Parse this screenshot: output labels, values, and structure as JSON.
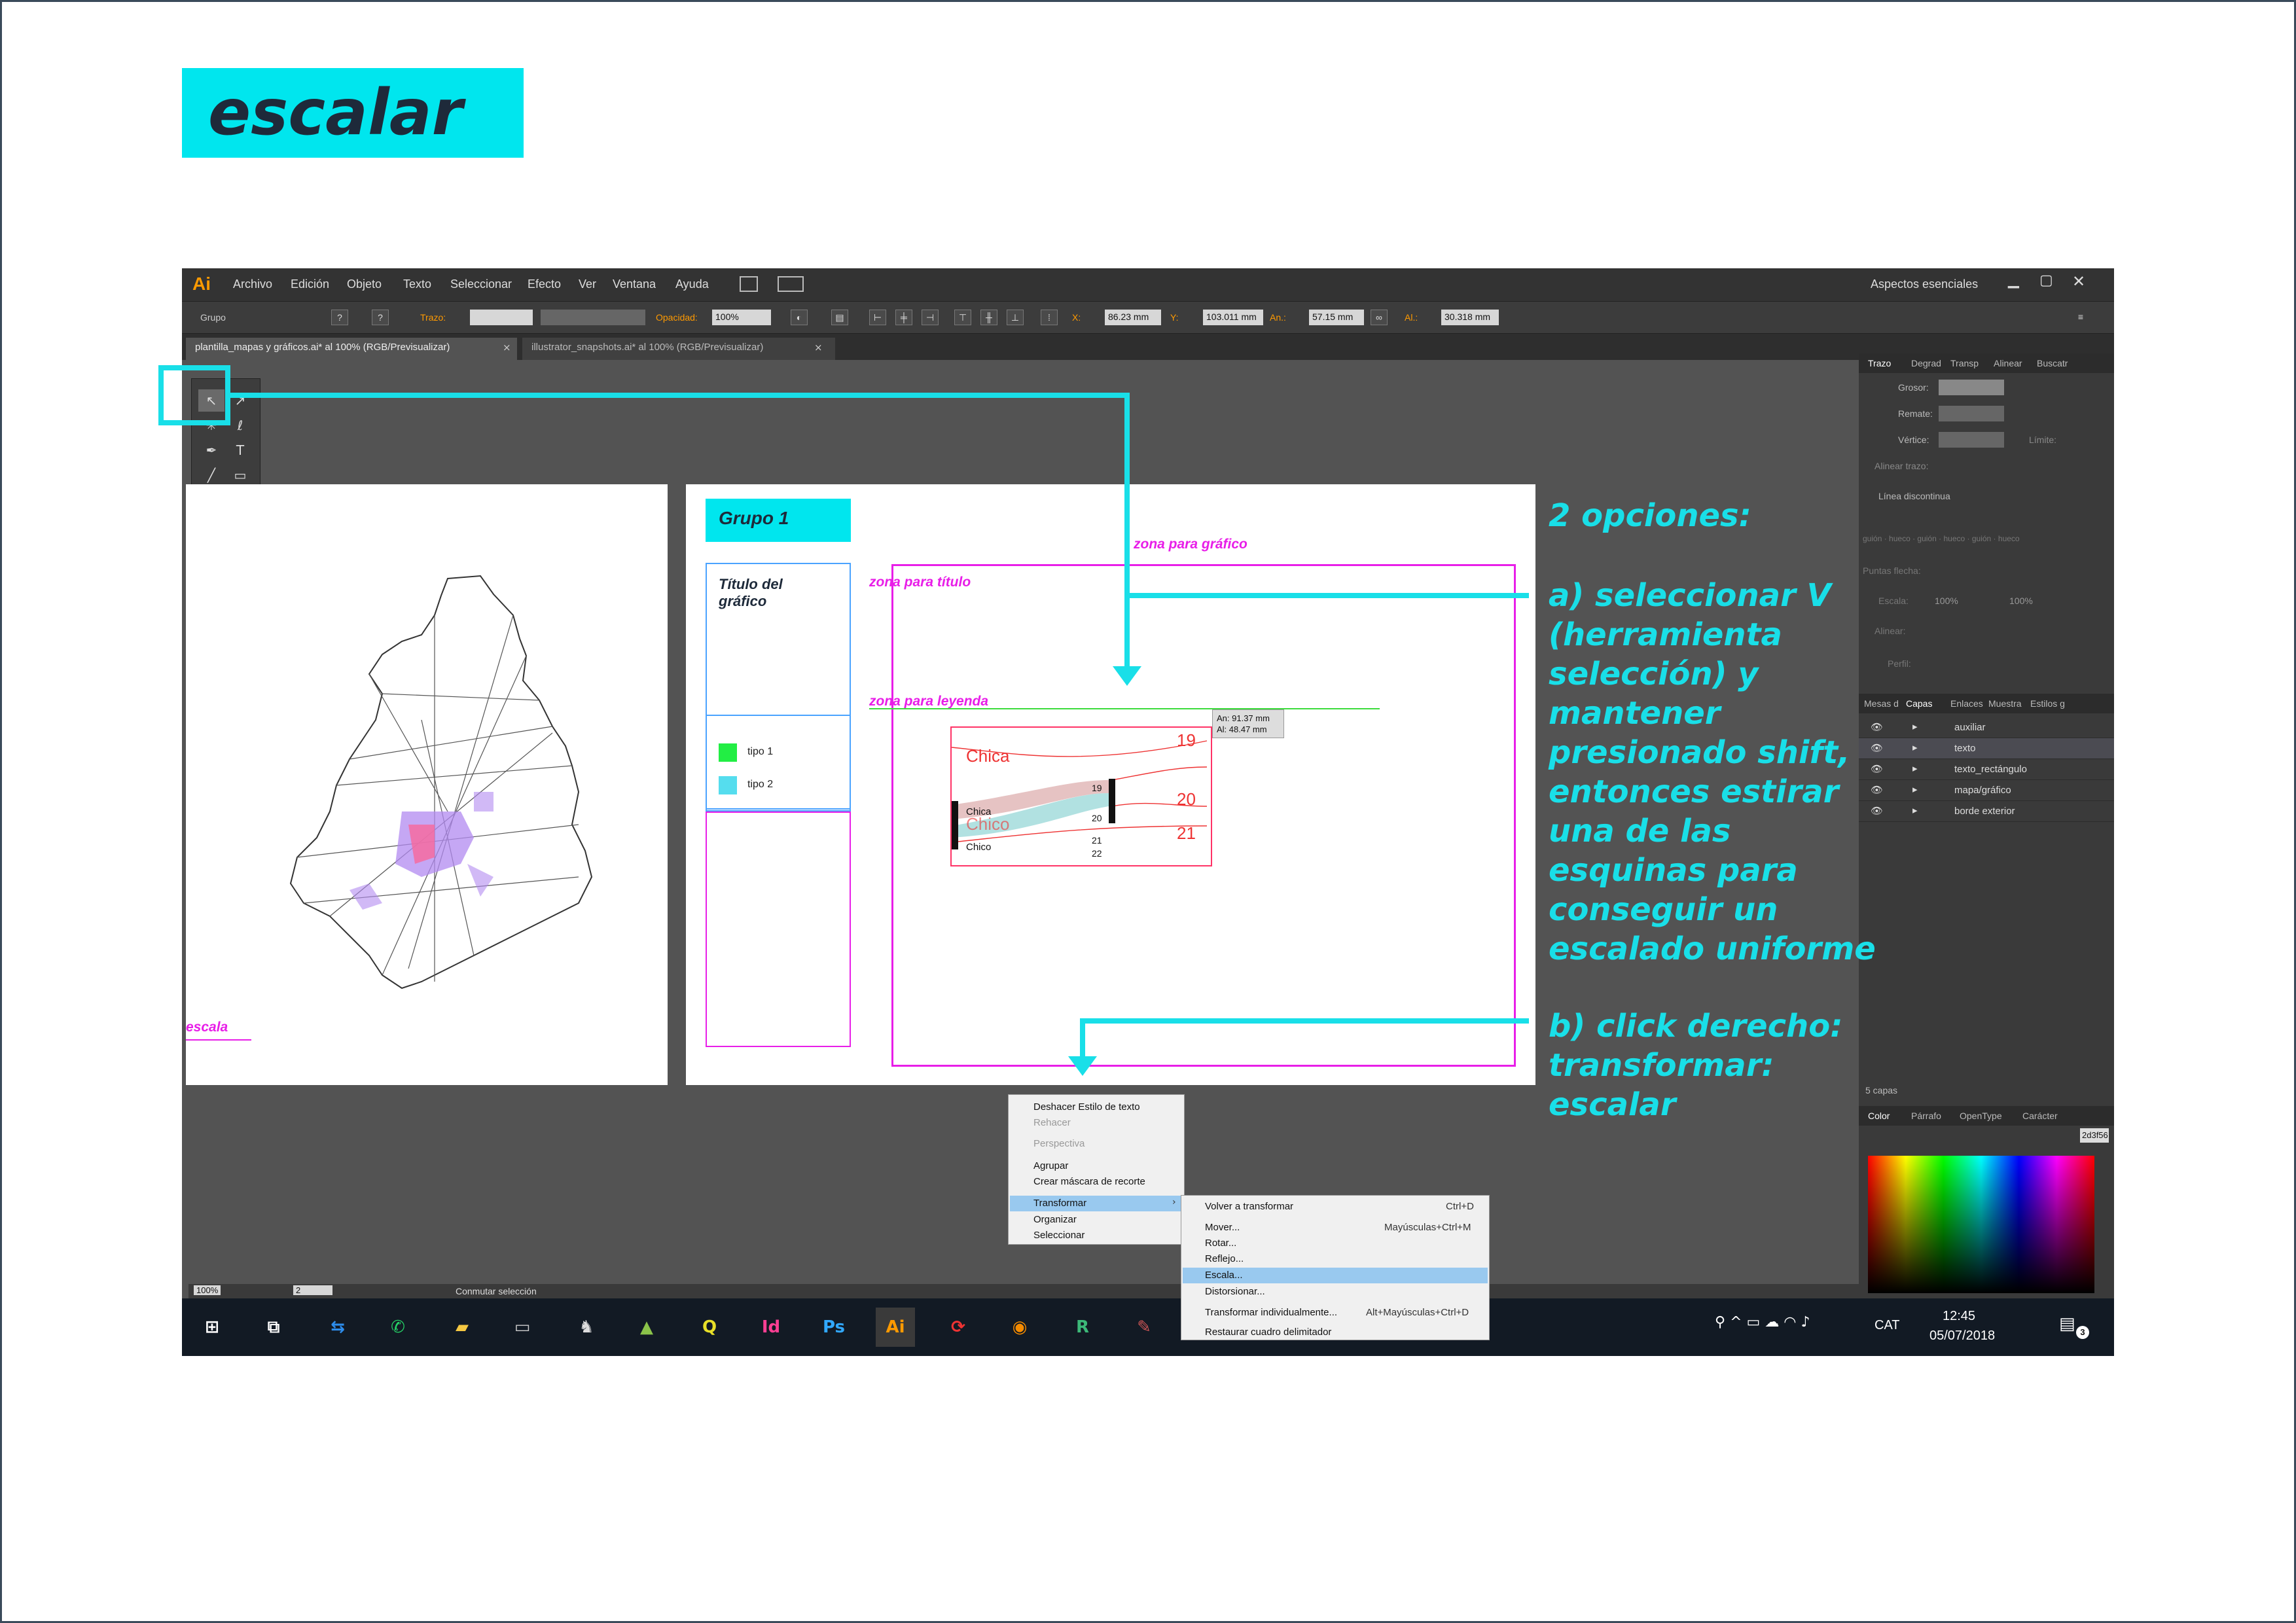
{
  "slide": {
    "title": "escalar"
  },
  "app": {
    "logo": "Ai",
    "menu": [
      "Archivo",
      "Edición",
      "Objeto",
      "Texto",
      "Seleccionar",
      "Efecto",
      "Ver",
      "Ventana",
      "Ayuda"
    ],
    "workspace": "Aspectos esenciales"
  },
  "control": {
    "selection": "Grupo",
    "stroke_label": "Trazo:",
    "opacity_label": "Opacidad:",
    "opacity": "100%",
    "x_label": "X:",
    "x": "86.23 mm",
    "y_label": "Y:",
    "y": "103.011 mm",
    "w_label": "An.:",
    "w": "57.15 mm",
    "h_label": "Al.:",
    "h": "30.318 mm"
  },
  "tabs": [
    "plantilla_mapas y gráficos.ai* al 100% (RGB/Previsualizar)",
    "illustrator_snapshots.ai* al 100% (RGB/Previsualizar)"
  ],
  "artboard": {
    "group_label": "Grupo 1",
    "chart_title": "Título del gráfico",
    "zone_chart": "zona para gráfico",
    "zone_title": "zona para título",
    "zone_legend": "zona para leyenda",
    "legend": [
      {
        "label": "tipo 1",
        "color": "#22ee44"
      },
      {
        "label": "tipo 2",
        "color": "#55ddee"
      }
    ],
    "scale_label": "escala",
    "size_tip_w": "An: 91.37 mm",
    "size_tip_h": "Al: 48.47 mm",
    "sankey_left": [
      "Chica",
      "Chico"
    ],
    "sankey_mid": [
      "19",
      "20",
      "21",
      "22"
    ],
    "sankey_big": [
      "Chica",
      "Chico"
    ],
    "sankey_right": [
      "19",
      "20",
      "21"
    ]
  },
  "panel": {
    "tabs_top": [
      "Trazo",
      "Degrad",
      "Transp",
      "Alinear",
      "Buscatr"
    ],
    "grosor": "Grosor:",
    "remate": "Remate:",
    "vertice": "Vértice:",
    "limite": "Límite:",
    "alinear_trazo": "Alinear trazo:",
    "linea_discontinua": "Línea discontinua",
    "gaps": [
      "guión",
      "hueco",
      "guión",
      "hueco",
      "guión",
      "hueco"
    ],
    "puntas": "Puntas flecha:",
    "escala": "Escala:",
    "escala_val1": "100%",
    "escala_val2": "100%",
    "alinear": "Alinear:",
    "perfil": "Perfil:",
    "tabs_mid": [
      "Mesas d",
      "Capas",
      "Enlaces",
      "Muestra",
      "Estilos g"
    ],
    "layers": [
      "auxiliar",
      "texto",
      "texto_rectángulo",
      "mapa/gráfico",
      "borde exterior"
    ],
    "layers_count": "5 capas",
    "tabs_bot": [
      "Color",
      "Párrafo",
      "OpenType",
      "Carácter"
    ],
    "color_hex": "2d3f56"
  },
  "status": {
    "zoom": "100%",
    "page": "2",
    "info": "Conmutar selección"
  },
  "context_menu": {
    "items": [
      "Deshacer Estilo de texto",
      "Rehacer",
      "Perspectiva",
      "Agrupar",
      "Crear máscara de recorte",
      "Transformar",
      "Organizar",
      "Seleccionar"
    ]
  },
  "submenu": {
    "items": [
      {
        "label": "Volver a transformar",
        "shortcut": "Ctrl+D"
      },
      {
        "label": "Mover...",
        "shortcut": "Mayúsculas+Ctrl+M"
      },
      {
        "label": "Rotar...",
        "shortcut": ""
      },
      {
        "label": "Reflejo...",
        "shortcut": ""
      },
      {
        "label": "Escala...",
        "shortcut": ""
      },
      {
        "label": "Distorsionar...",
        "shortcut": ""
      },
      {
        "label": "Transformar individualmente...",
        "shortcut": "Alt+Mayúsculas+Ctrl+D"
      },
      {
        "label": "Restaurar cuadro delimitador",
        "shortcut": ""
      }
    ]
  },
  "taskbar": {
    "time": "12:45",
    "date": "05/07/2018",
    "lang": "CAT",
    "notif": "3",
    "apps": [
      "Id",
      "Ps",
      "Ai"
    ]
  },
  "annotation": {
    "heading": "2 opciones:",
    "a": [
      "a) seleccionar V",
      "(herramienta",
      "selección) y",
      "mantener",
      "presionado shift,",
      "entonces estirar",
      "una de las",
      "esquinas para",
      "conseguir un",
      "escalado uniforme"
    ],
    "b": [
      "b) click derecho:",
      "transformar:",
      "escalar"
    ]
  }
}
